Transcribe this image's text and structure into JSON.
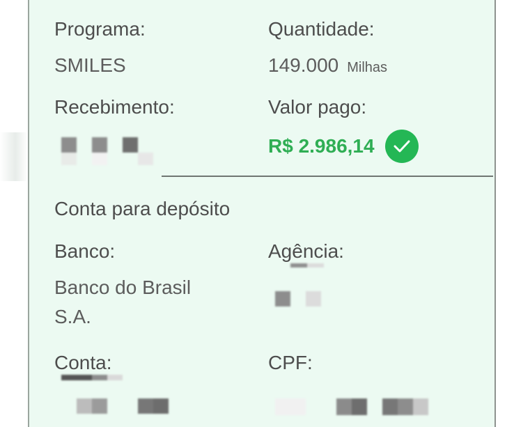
{
  "program": {
    "label": "Programa:",
    "value": "SMILES"
  },
  "quantity": {
    "label": "Quantidade:",
    "value": "149.000",
    "unit": "Milhas"
  },
  "receipt": {
    "label": "Recebimento:"
  },
  "paid": {
    "label": "Valor pago:",
    "value": "R$ 2.986,14",
    "status_icon": "check-circle-icon",
    "color": "#2fae54"
  },
  "deposit": {
    "section_title": "Conta para depósito",
    "bank_label": "Banco:",
    "bank_value_line1": "Banco do Brasil",
    "bank_value_line2": "S.A.",
    "agency_label": "Agência:",
    "account_label": "Conta:",
    "cpf_label": "CPF:"
  }
}
